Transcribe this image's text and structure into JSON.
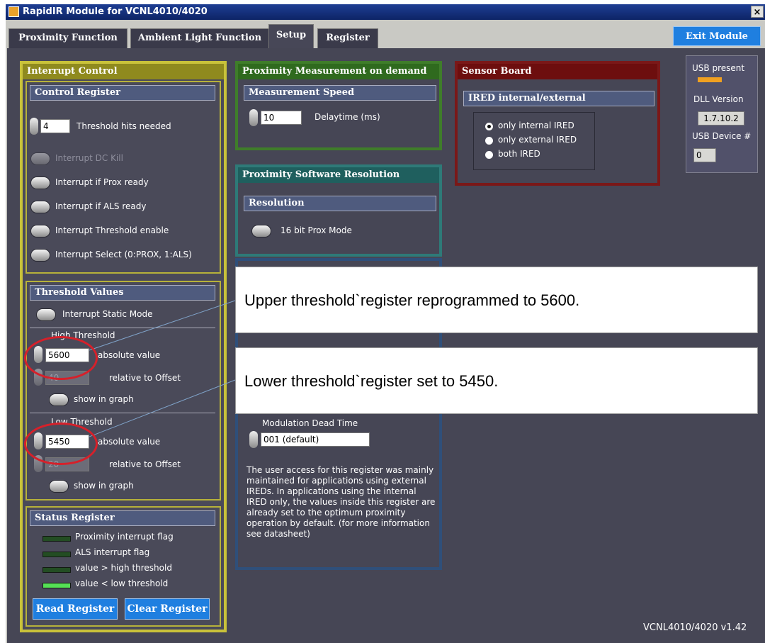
{
  "window": {
    "title": "RapidIR Module for VCNL4010/4020",
    "close": "×"
  },
  "tabs": [
    "Proximity Function",
    "Ambient Light Function",
    "Setup",
    "Register"
  ],
  "active_tab": "Setup",
  "exit_button": "Exit Module",
  "interrupt_control": {
    "title": "Interrupt Control",
    "control_register": {
      "title": "Control Register",
      "threshold_hits_value": "4",
      "threshold_hits_label": "Threshold hits needed",
      "toggles": [
        "Interrupt DC Kill",
        "Interrupt if Prox ready",
        "Interrupt if ALS ready",
        "Interrupt Threshold enable",
        "Interrupt Select (0:PROX, 1:ALS)"
      ]
    },
    "threshold_values": {
      "title": "Threshold Values",
      "static_mode": "Interrupt Static Mode",
      "high": {
        "title": "High Threshold",
        "value": "5600",
        "absolute_label": "absolute value",
        "offset_value": "40",
        "offset_label": "relative to Offset",
        "graph_label": "show in graph"
      },
      "low": {
        "title": "Low Threshold",
        "value": "5450",
        "absolute_label": "absolute value",
        "offset_value": "20",
        "offset_label": "relative to Offset",
        "graph_label": "show in graph"
      }
    },
    "status_register": {
      "title": "Status Register",
      "flags": [
        {
          "label": "Proximity interrupt flag",
          "on": false
        },
        {
          "label": "ALS interrupt flag",
          "on": false
        },
        {
          "label": "value > high threshold",
          "on": false
        },
        {
          "label": "value < low threshold",
          "on": true
        }
      ],
      "read_button": "Read Register",
      "clear_button": "Clear Register"
    }
  },
  "prox_on_demand": {
    "title": "Proximity Measurement on demand",
    "speed_title": "Measurement Speed",
    "delay_value": "10",
    "delay_label": "Delaytime (ms)"
  },
  "prox_resolution": {
    "title": "Proximity Software Resolution",
    "resolution_title": "Resolution",
    "mode_label": "16 bit Prox Mode"
  },
  "modulation": {
    "dead_time_label": "Modulation Dead Time",
    "dead_time_value": "001 (default)",
    "note": "The user access for this register was mainly maintained for applications using external IREDs. In applications using the internal IRED only, the values inside this register are already set to the optimum proximity operation by default. (for more information see datasheet)"
  },
  "sensor_board": {
    "title": "Sensor Board",
    "ired_title": "IRED internal/external",
    "options": [
      "only internal IRED",
      "only external IRED",
      "both IRED"
    ],
    "selected": "only internal IRED"
  },
  "usb": {
    "present_label": "USB present",
    "dll_label": "DLL Version",
    "dll_value": "1.7.10.2",
    "device_label": "USB Device #",
    "device_value": "0"
  },
  "callouts": {
    "upper": "Upper threshold`register reprogrammed to 5600.",
    "lower": "Lower threshold`register set to 5450."
  },
  "version": "VCNL4010/4020 v1.42",
  "colors": {
    "panel": "#464655",
    "interrupt_frame": "#c9c23a",
    "prox_frame": "#3f7d2a",
    "resolution_frame": "#2e7a78",
    "sensor_frame": "#7a1818",
    "button_blue": "#1f7fe0",
    "callout_ring": "#d6202a"
  }
}
